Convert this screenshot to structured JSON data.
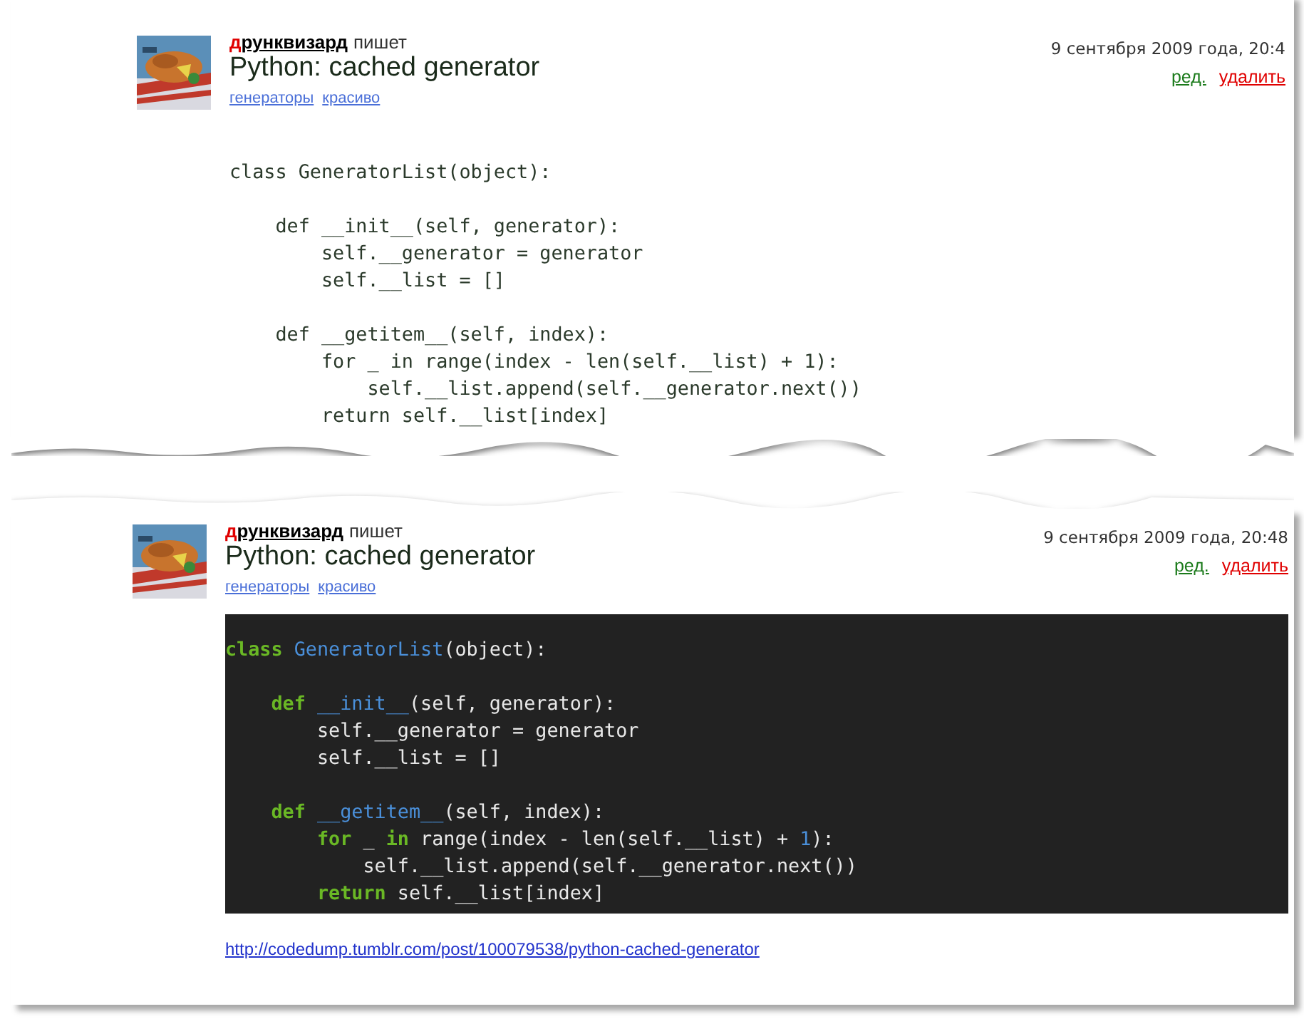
{
  "posts": [
    {
      "author": {
        "initial": "д",
        "rest": "рунквизард"
      },
      "verb": "пишет",
      "title": "Python: cached generator",
      "tags": [
        "генераторы",
        "красиво"
      ],
      "date": "9 сентября 2009 года, 20:4",
      "actions": [
        {
          "label": "ред.",
          "kind": "edit"
        },
        {
          "label": "удалить",
          "kind": "delete"
        }
      ],
      "code": {
        "kind": "plain",
        "blocks": [
          [
            {
              "tokens": [
                {
                  "text": "class GeneratorList(object):",
                  "kind": "plain"
                }
              ]
            }
          ],
          [
            {
              "tokens": [
                {
                  "text": "    def __init__(self, generator):",
                  "kind": "plain"
                }
              ]
            },
            {
              "tokens": [
                {
                  "text": "        self.__generator = generator",
                  "kind": "plain"
                }
              ]
            },
            {
              "tokens": [
                {
                  "text": "        self.__list = []",
                  "kind": "plain"
                }
              ]
            }
          ],
          [
            {
              "tokens": [
                {
                  "text": "    def __getitem__(self, index):",
                  "kind": "plain"
                }
              ]
            },
            {
              "tokens": [
                {
                  "text": "        for _ in range(index - len(self.__list) + 1):",
                  "kind": "plain"
                }
              ]
            },
            {
              "tokens": [
                {
                  "text": "            self.__list.append(self.__generator.next())",
                  "kind": "plain"
                }
              ]
            },
            {
              "tokens": [
                {
                  "text": "        return self.__list[index]",
                  "kind": "plain"
                }
              ]
            }
          ]
        ]
      }
    },
    {
      "author": {
        "initial": "д",
        "rest": "рунквизард"
      },
      "verb": "пишет",
      "title": "Python: cached generator",
      "tags": [
        "генераторы",
        "красиво"
      ],
      "date": "9 сентября 2009 года, 20:48",
      "actions": [
        {
          "label": "ред.",
          "kind": "edit"
        },
        {
          "label": "удалить",
          "kind": "delete"
        }
      ],
      "code": {
        "kind": "dark",
        "blocks": [
          [
            {
              "tokens": [
                {
                  "text": "class",
                  "kind": "keyword"
                },
                {
                  "text": " GeneratorList",
                  "kind": "name"
                },
                {
                  "text": "(object):",
                  "kind": "plain"
                }
              ]
            }
          ],
          [
            {
              "tokens": [
                {
                  "text": "    def",
                  "kind": "keyword"
                },
                {
                  "text": " __init__",
                  "kind": "name"
                },
                {
                  "text": "(self, generator):",
                  "kind": "plain"
                }
              ]
            },
            {
              "tokens": [
                {
                  "text": "        self.__generator = generator",
                  "kind": "plain"
                }
              ]
            },
            {
              "tokens": [
                {
                  "text": "        self.__list = []",
                  "kind": "plain"
                }
              ]
            }
          ],
          [
            {
              "tokens": [
                {
                  "text": "    def",
                  "kind": "keyword"
                },
                {
                  "text": " __getitem__",
                  "kind": "name"
                },
                {
                  "text": "(self, index):",
                  "kind": "plain"
                }
              ]
            },
            {
              "tokens": [
                {
                  "text": "        for",
                  "kind": "keyword"
                },
                {
                  "text": " _ ",
                  "kind": "plain"
                },
                {
                  "text": "in",
                  "kind": "keyword"
                },
                {
                  "text": " range(index - len(self.__list) + ",
                  "kind": "plain"
                },
                {
                  "text": "1",
                  "kind": "number"
                },
                {
                  "text": "):",
                  "kind": "plain"
                }
              ]
            },
            {
              "tokens": [
                {
                  "text": "            self.__list.append(self.__generator.next())",
                  "kind": "plain"
                }
              ]
            },
            {
              "tokens": [
                {
                  "text": "        return",
                  "kind": "keyword"
                },
                {
                  "text": " self.__list[index]",
                  "kind": "plain"
                }
              ]
            }
          ]
        ]
      },
      "link": "http://codedump.tumblr.com/post/100079538/python-cached-generator"
    }
  ]
}
